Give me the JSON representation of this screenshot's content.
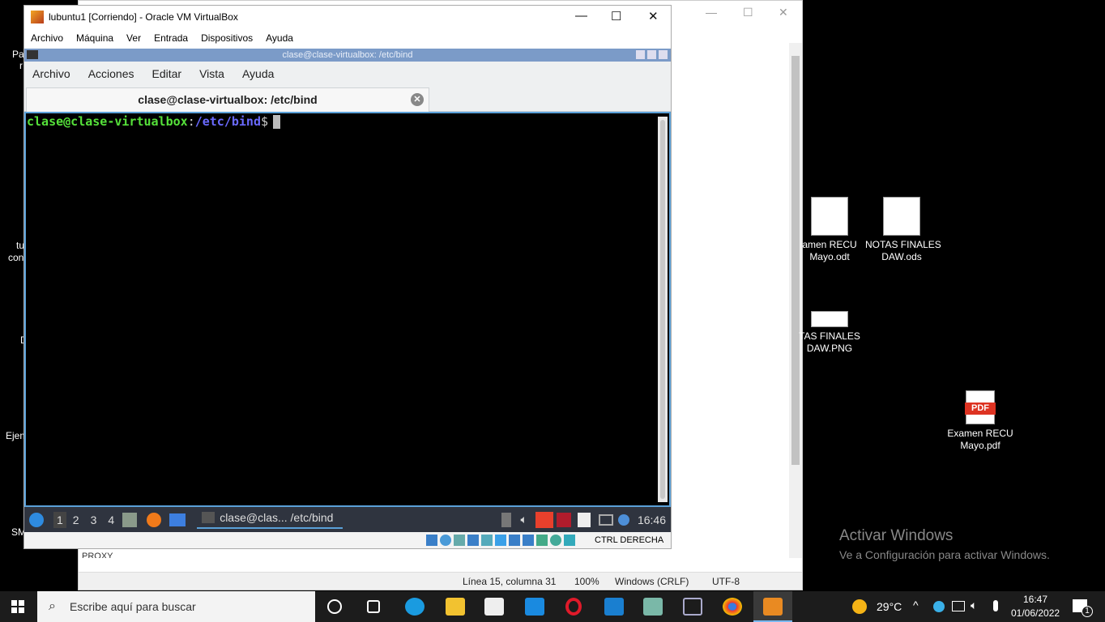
{
  "desktop": {
    "left_fragments": [
      "Pa",
      "r",
      "tu",
      "con",
      "D",
      "Ejem",
      "SM"
    ],
    "icons": [
      {
        "label": "amen RECU\nMayo.odt"
      },
      {
        "label": "NOTAS FINALES\nDAW.ods"
      },
      {
        "label": "TAS FINALES\nDAW.PNG"
      },
      {
        "label": "Examen RECU\nMayo.pdf",
        "badge": "PDF"
      }
    ],
    "watermark": {
      "title": "Activar Windows",
      "subtitle": "Ve a Configuración para activar Windows."
    }
  },
  "notepad": {
    "partial_text": "PROXY",
    "status": {
      "position": "Línea 15, columna 31",
      "zoom": "100%",
      "eol": "Windows (CRLF)",
      "encoding": "UTF-8"
    }
  },
  "virtualbox": {
    "title": "lubuntu1 [Corriendo] - Oracle VM VirtualBox",
    "menu": [
      "Archivo",
      "Máquina",
      "Ver",
      "Entrada",
      "Dispositivos",
      "Ayuda"
    ],
    "host_key": "CTRL DERECHA"
  },
  "terminal": {
    "window_title": "clase@clase-virtualbox: /etc/bind",
    "menu": [
      "Archivo",
      "Acciones",
      "Editar",
      "Vista",
      "Ayuda"
    ],
    "tab_label": "clase@clase-virtualbox: /etc/bind",
    "prompt_user": "clase@clase-virtualbox",
    "prompt_sep": ":",
    "prompt_path": "/etc/bind",
    "prompt_end": "$"
  },
  "lxqt_panel": {
    "workspaces": [
      "1",
      "2",
      "3",
      "4"
    ],
    "task": "clase@clas... /etc/bind",
    "clock": "16:46"
  },
  "taskbar": {
    "search_placeholder": "Escribe aquí para buscar",
    "weather": "29°C",
    "time": "16:47",
    "date": "01/06/2022",
    "notifications": "1"
  },
  "colors": {
    "prompt_green": "#55e03a",
    "prompt_blue": "#6a6aff",
    "lxqt_title": "#7b9bc8"
  }
}
